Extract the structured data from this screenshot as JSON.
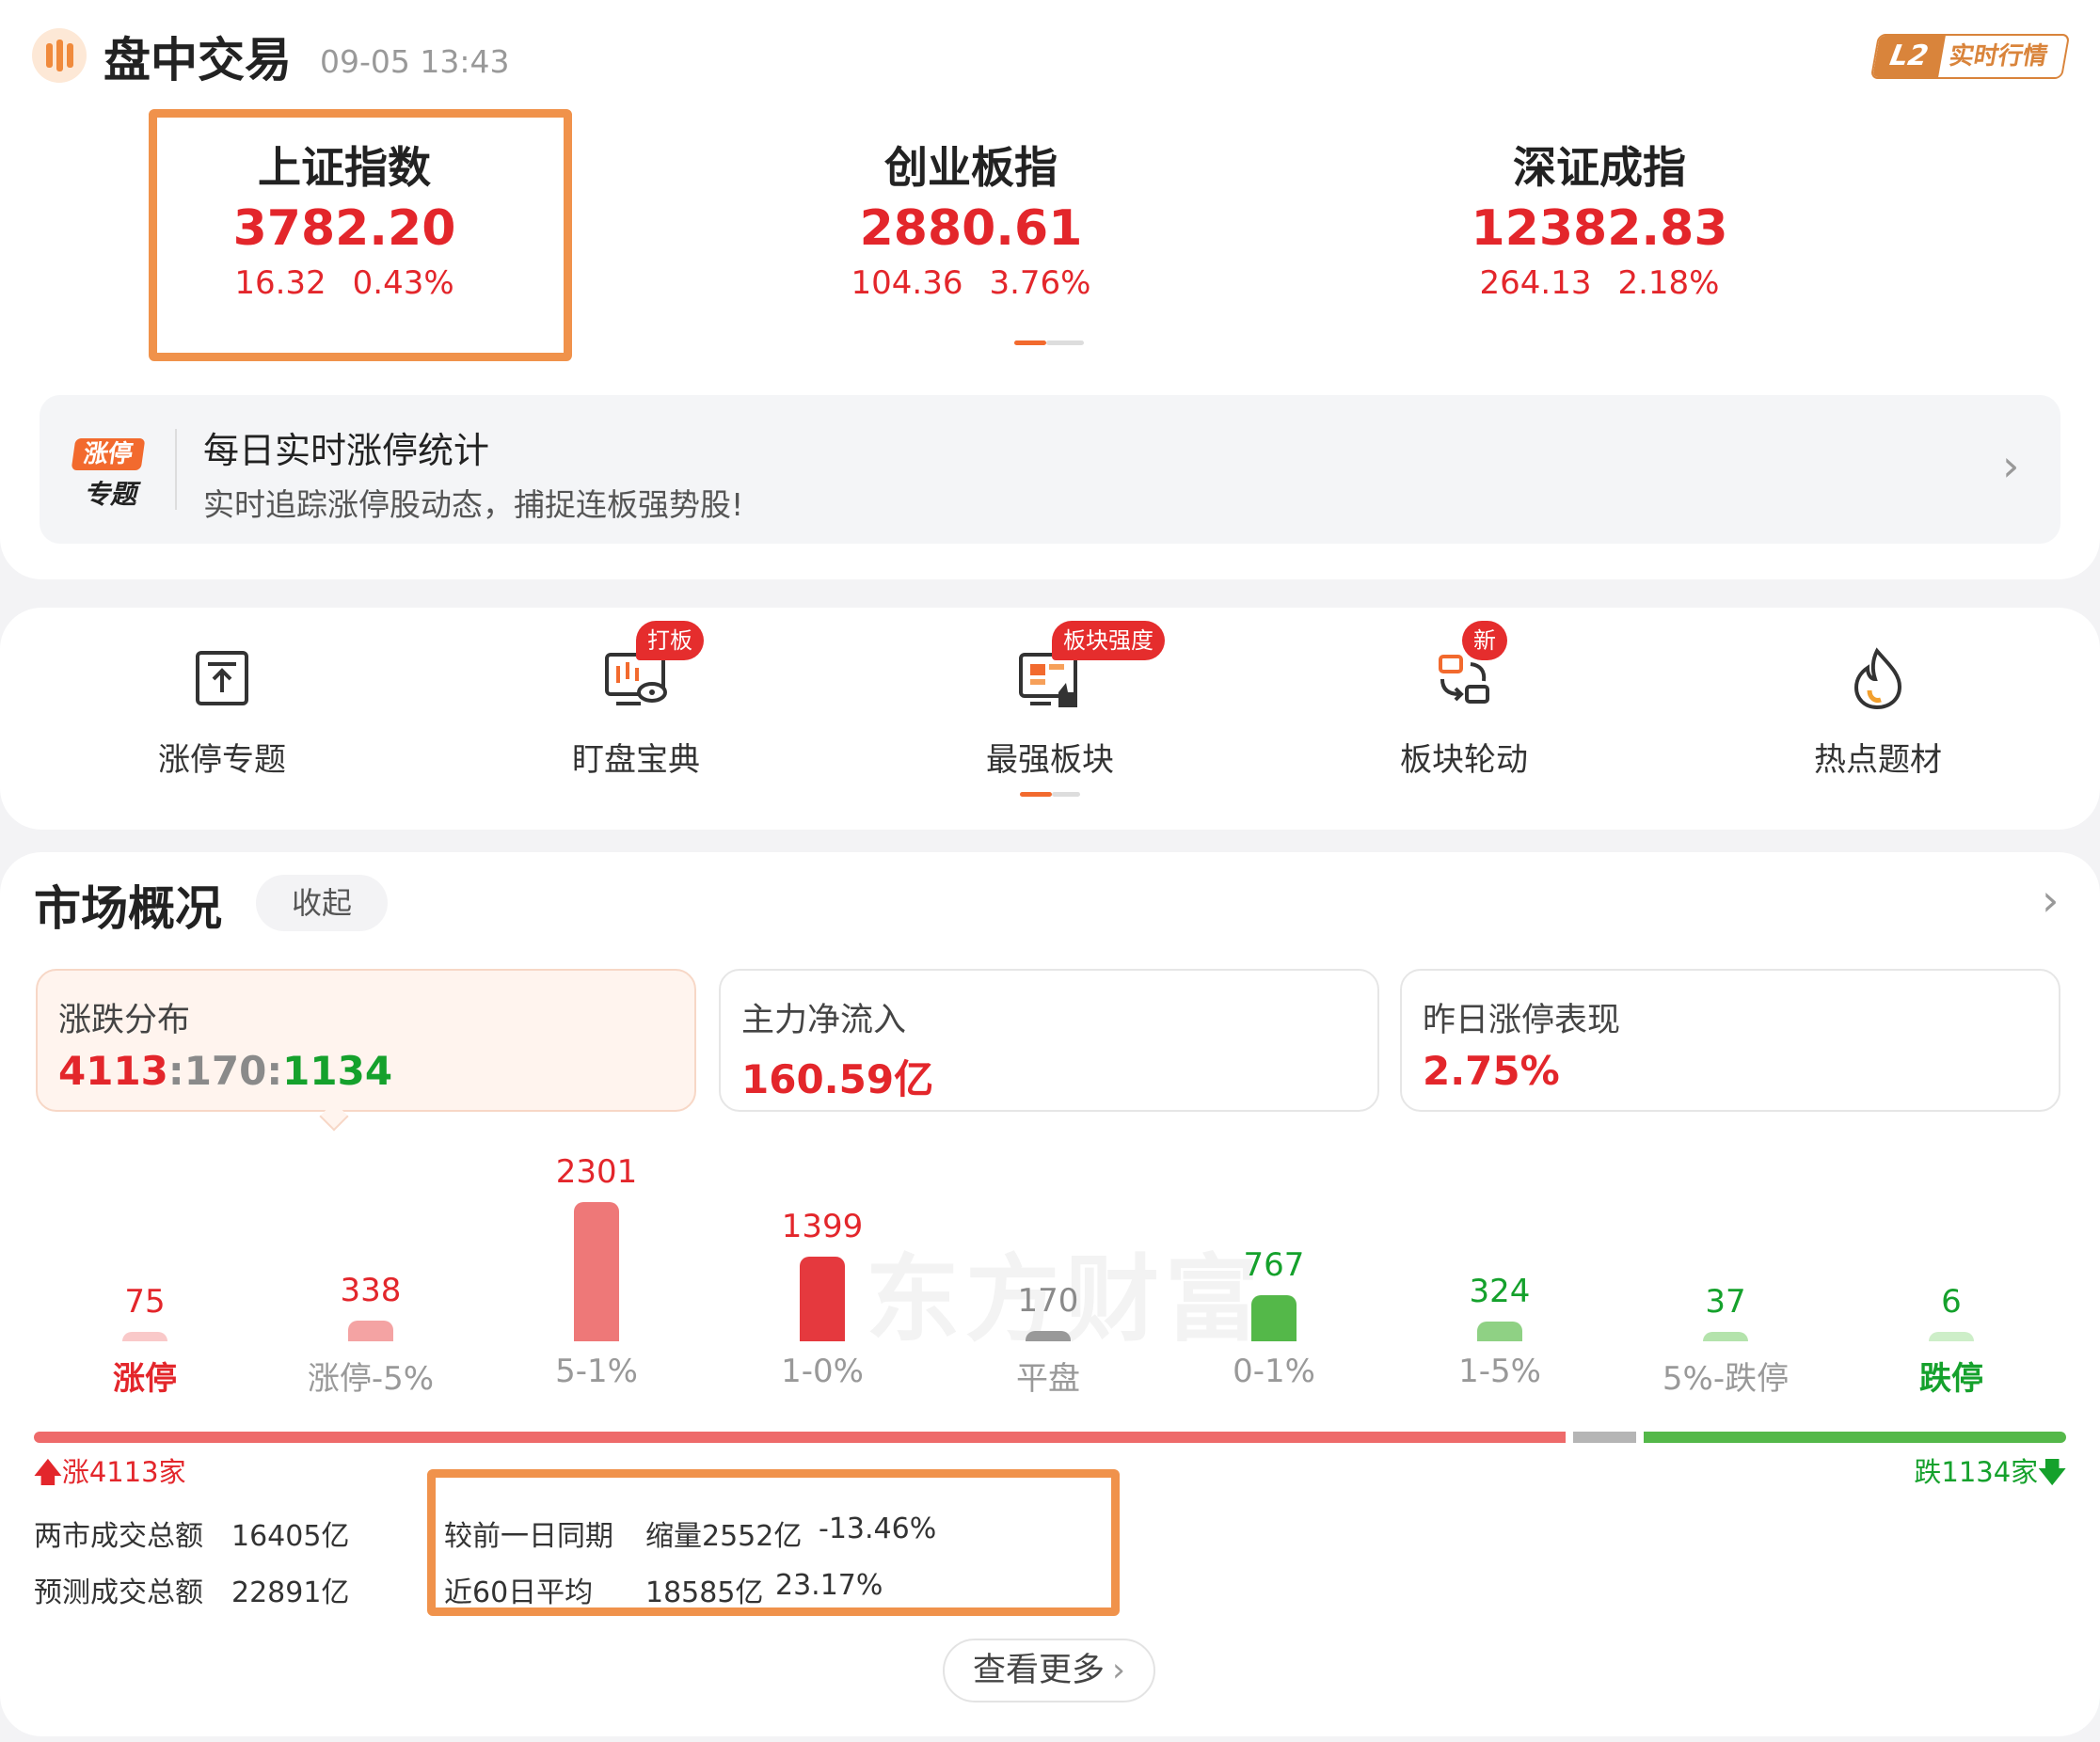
{
  "header": {
    "title": "盘中交易",
    "time": "09-05 13:43",
    "badge_l2": "L2",
    "badge_text": "实时行情"
  },
  "indices": [
    {
      "name": "上证指数",
      "value": "3782.20",
      "change": "16.32",
      "pct": "0.43%"
    },
    {
      "name": "创业板指",
      "value": "2880.61",
      "change": "104.36",
      "pct": "3.76%"
    },
    {
      "name": "深证成指",
      "value": "12382.83",
      "change": "264.13",
      "pct": "2.18%"
    }
  ],
  "banner": {
    "icon_top": "涨停",
    "icon_bottom": "专题",
    "title": "每日实时涨停统计",
    "subtitle": "实时追踪涨停股动态，捕捉连板强势股!"
  },
  "shortcuts": [
    {
      "label": "涨停专题",
      "icon": "upload-box-icon",
      "tag": ""
    },
    {
      "label": "盯盘宝典",
      "icon": "monitor-eye-icon",
      "tag": "打板"
    },
    {
      "label": "最强板块",
      "icon": "board-thumb-icon",
      "tag": "板块强度"
    },
    {
      "label": "板块轮动",
      "icon": "rotate-icon",
      "tag": "新"
    },
    {
      "label": "热点题材",
      "icon": "flame-icon",
      "tag": ""
    }
  ],
  "market": {
    "title": "市场概况",
    "collapse_label": "收起",
    "stats": [
      {
        "label": "涨跌分布",
        "up": "4113",
        "sep1": ":",
        "flat": "170",
        "sep2": ":",
        "down": "1134"
      },
      {
        "label": "主力净流入",
        "value": "160.59亿"
      },
      {
        "label": "昨日涨停表现",
        "value": "2.75%"
      }
    ],
    "watermark": "东方财富"
  },
  "chart_data": {
    "type": "bar",
    "categories": [
      "涨停",
      "涨停-5%",
      "5-1%",
      "1-0%",
      "平盘",
      "0-1%",
      "1-5%",
      "5%-跌停",
      "跌停"
    ],
    "values": [
      75,
      338,
      2301,
      1399,
      170,
      767,
      324,
      37,
      6
    ],
    "colors": [
      "#f9c9c9",
      "#f4a3a3",
      "#ee7878",
      "#e5393e",
      "#999999",
      "#54b849",
      "#8fd184",
      "#b4e3ac",
      "#cdeec8"
    ]
  },
  "ratio_bar": {
    "up_count": 4113,
    "flat_count": 170,
    "down_count": 1134,
    "up_label": "涨4113家",
    "down_label": "跌1134家"
  },
  "turnover": {
    "total_label": "两市成交总额",
    "total_value": "16405亿",
    "forecast_label": "预测成交总额",
    "forecast_value": "22891亿",
    "prev_label": "较前一日同期",
    "prev_value": "缩量2552亿",
    "prev_pct": "-13.46%",
    "avg_label": "近60日平均",
    "avg_value": "18585亿",
    "avg_pct": "23.17%"
  },
  "more_label": "查看更多",
  "colors": {
    "up": "#e3262b",
    "down": "#15a12c",
    "accent": "#f26a2e",
    "highlight": "#f0924b"
  }
}
